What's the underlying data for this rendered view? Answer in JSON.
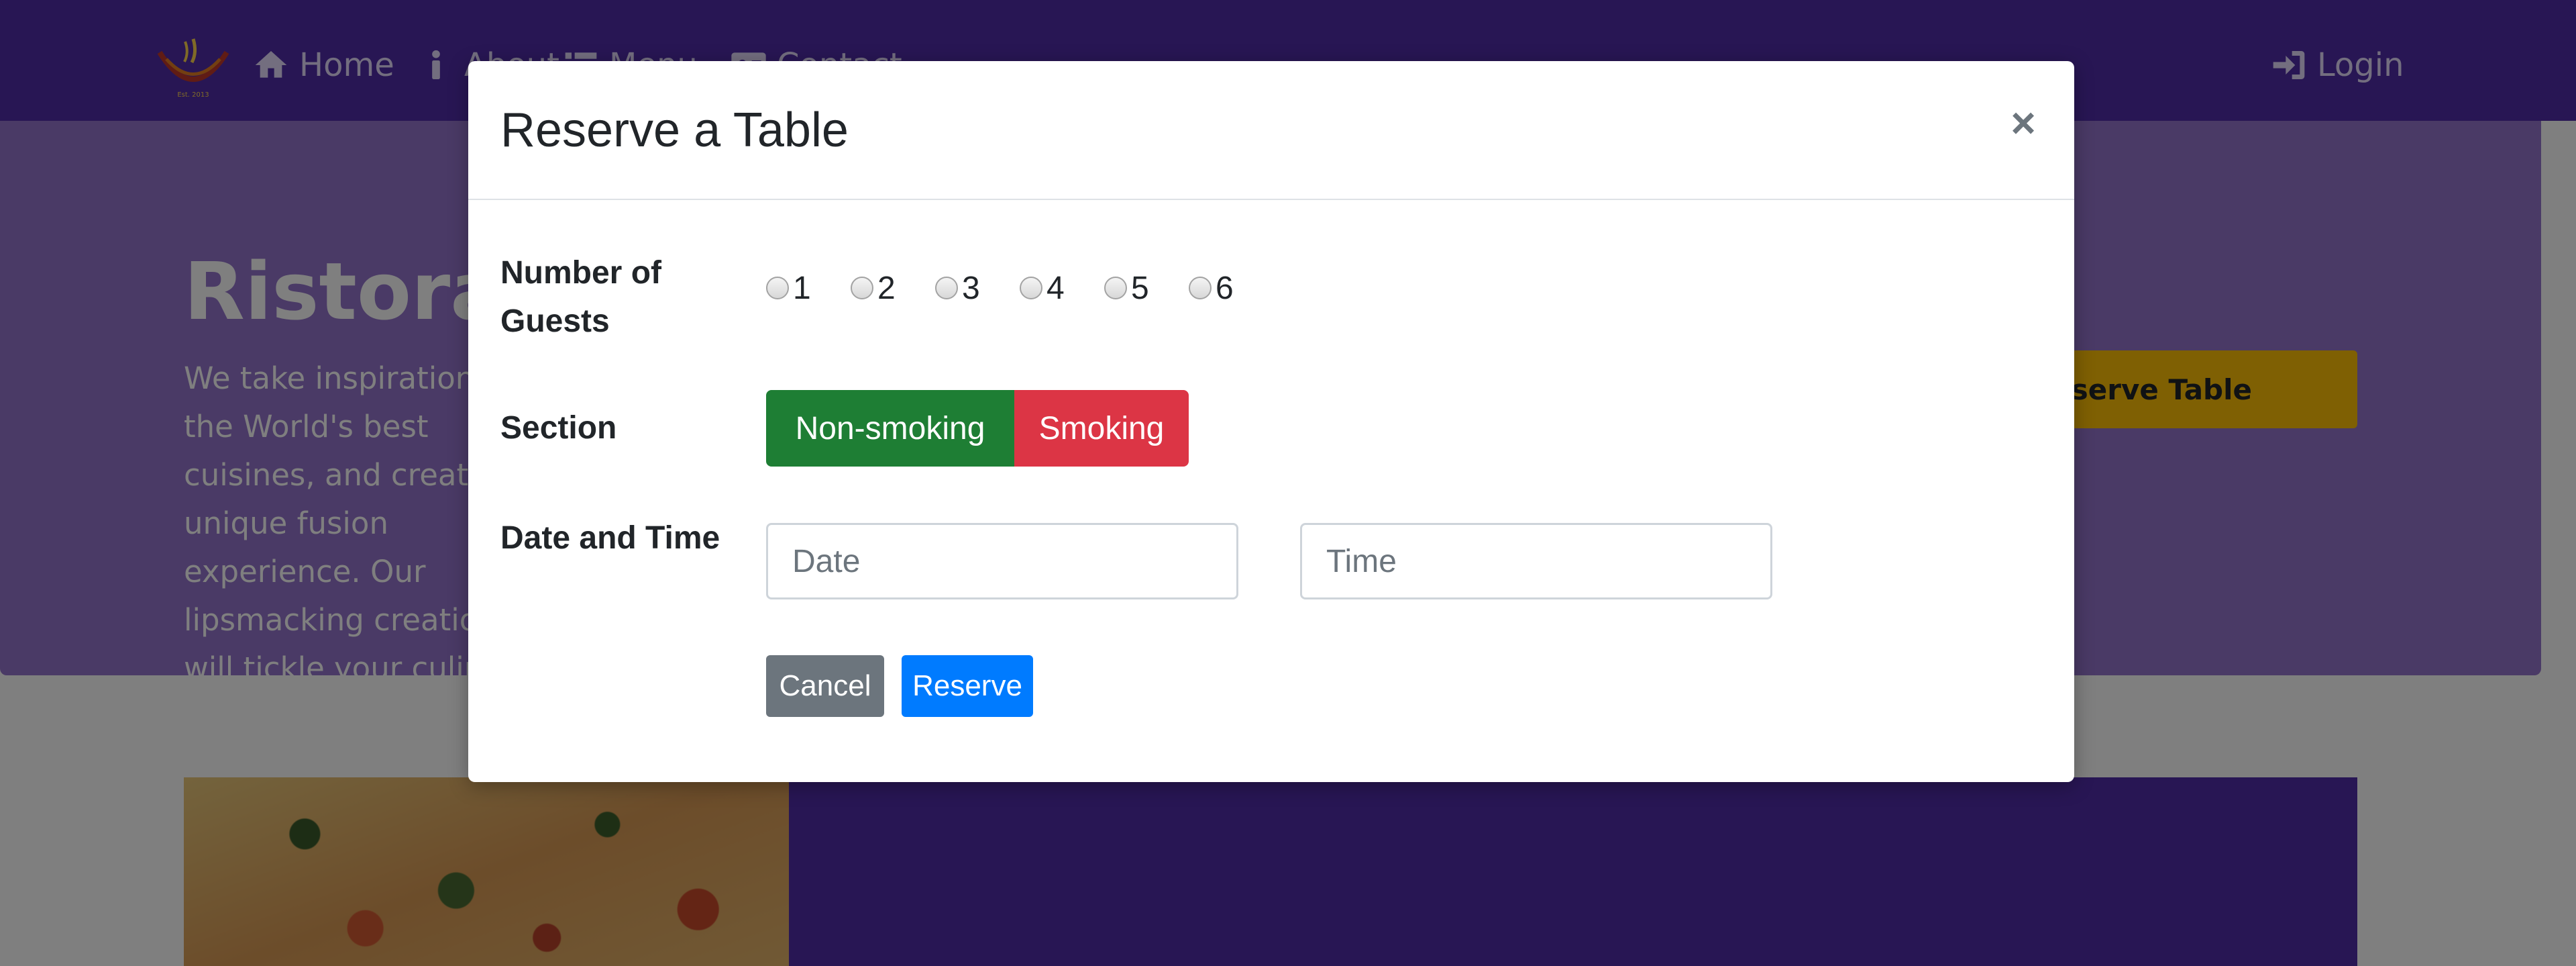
{
  "navbar": {
    "links": [
      {
        "label": "Home",
        "icon": "home-icon"
      },
      {
        "label": "About",
        "icon": "info-icon"
      },
      {
        "label": "Menu",
        "icon": "list-icon"
      },
      {
        "label": "Contact",
        "icon": "address-card-icon"
      }
    ],
    "login": {
      "label": "Login",
      "icon": "sign-in-icon"
    },
    "logo_text": "Est. 2013"
  },
  "jumbotron": {
    "title": "Ristorante Con Fusion",
    "text": "We take inspiration from the World's best cuisines, and create a unique fusion experience. Our lipsmacking creations will tickle your culinary senses!",
    "reserve_button": "Reserve Table"
  },
  "modal": {
    "title": "Reserve a Table",
    "close_label": "×",
    "guests": {
      "label": "Number of Guests",
      "options": [
        "1",
        "2",
        "3",
        "4",
        "5",
        "6"
      ]
    },
    "section": {
      "label": "Section",
      "options": [
        "Non-smoking",
        "Smoking"
      ]
    },
    "datetime": {
      "label": "Date and Time",
      "date_placeholder": "Date",
      "time_placeholder": "Time"
    },
    "cancel_label": "Cancel",
    "reserve_label": "Reserve"
  },
  "colors": {
    "navbar": "#512da8",
    "jumbotron": "#9575cd",
    "reserve_table_button": "#ffc107",
    "non_smoking": "#1e7e34",
    "smoking": "#dc3545",
    "cancel": "#6c757d",
    "reserve": "#007bff"
  }
}
